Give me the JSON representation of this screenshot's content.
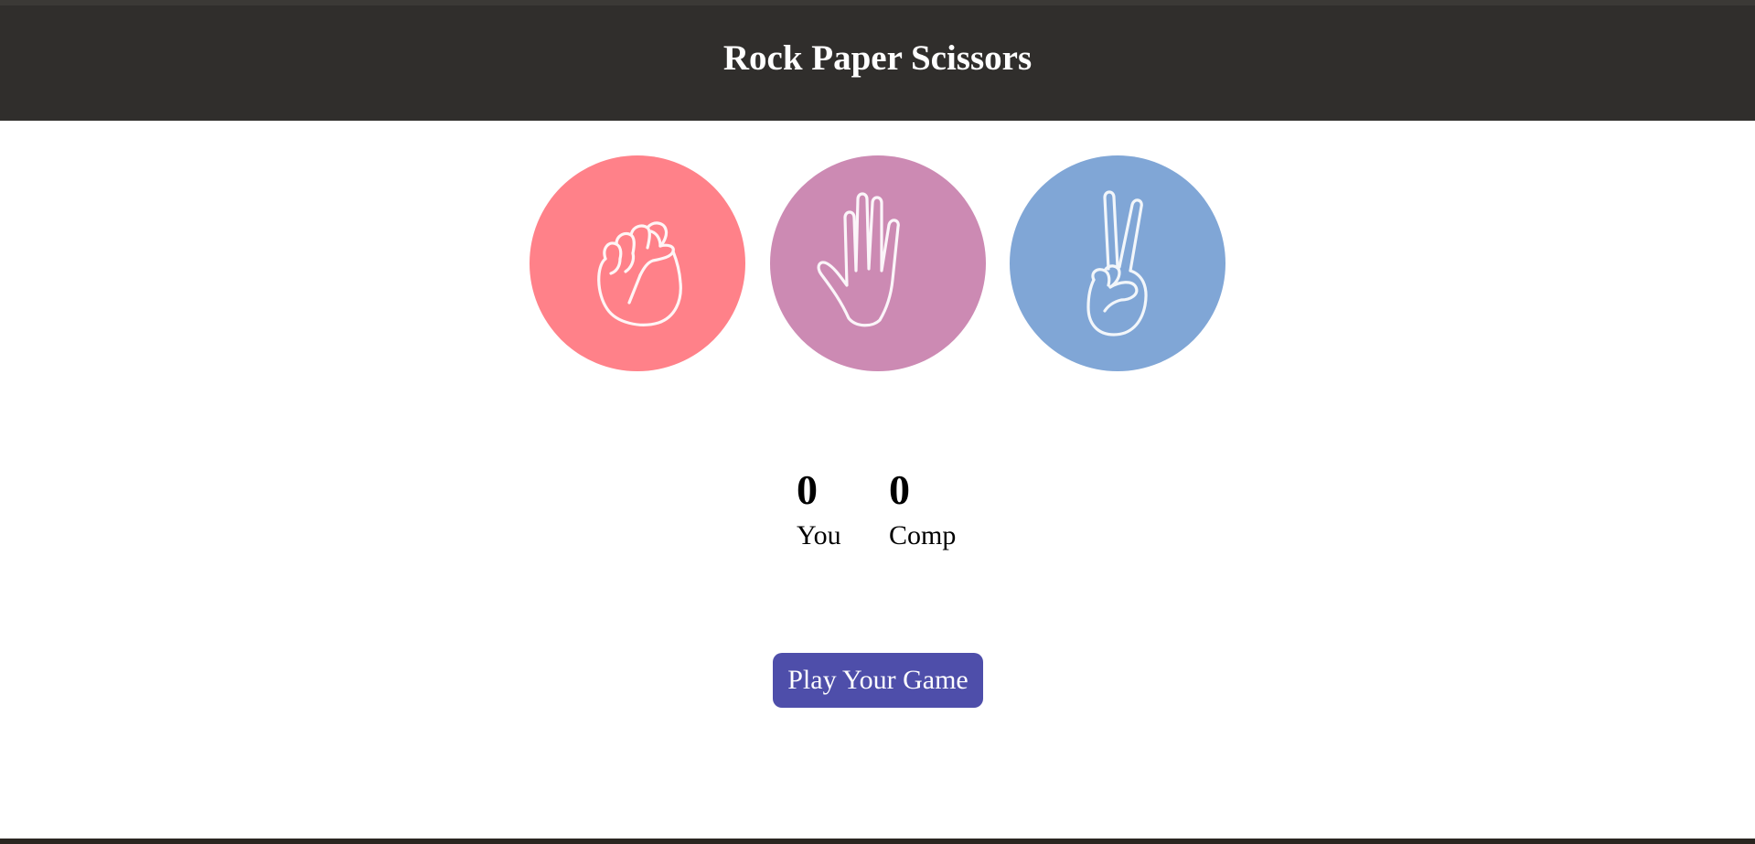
{
  "header": {
    "title": "Rock Paper Scissors"
  },
  "choices": [
    {
      "id": "rock",
      "icon": "fist-icon",
      "color": "#ff8189"
    },
    {
      "id": "paper",
      "icon": "open-hand-icon",
      "color": "#cc8ab3"
    },
    {
      "id": "scissors",
      "icon": "peace-sign-icon",
      "color": "#80a6d6"
    }
  ],
  "scoreboard": {
    "you": {
      "value": "0",
      "label": "You"
    },
    "comp": {
      "value": "0",
      "label": "Comp"
    }
  },
  "play_button": {
    "label": "Play Your Game",
    "color": "#4e4eaa"
  },
  "colors": {
    "header_bg": "#302e2c",
    "header_text": "#ffffff"
  }
}
